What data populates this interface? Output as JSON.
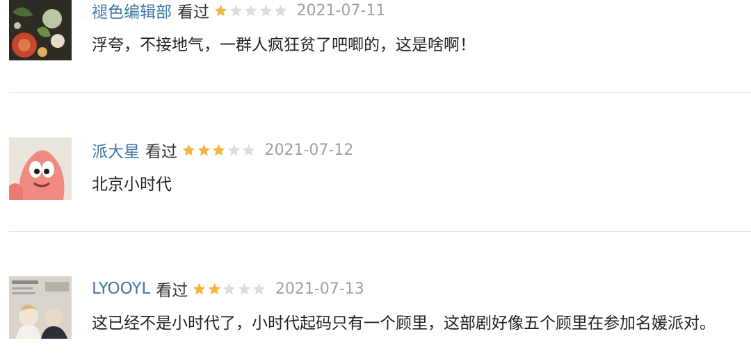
{
  "comments": [
    {
      "username": "褪色编辑部",
      "status": "看过",
      "rating": 1,
      "date": "2021-07-11",
      "text": "浮夸，不接地气，一群人疯狂贫了吧唧的，这是啥啊！",
      "avatar": "avatar-floral"
    },
    {
      "username": "派大星",
      "status": "看过",
      "rating": 3,
      "date": "2021-07-12",
      "text": "北京小时代",
      "avatar": "avatar-patrick"
    },
    {
      "username": "LYOOYL",
      "status": "看过",
      "rating": 2,
      "date": "2021-07-13",
      "text": "这已经不是小时代了，小时代起码只有一个顾里，这部剧好像五个顾里在参加名媛派对。",
      "avatar": "avatar-magazine"
    }
  ],
  "colors": {
    "username": "#3f77a6",
    "star_on": "#f7b43a",
    "star_off": "#dcdcdc",
    "date": "#a0a0a0",
    "divider": "#e6e6e6"
  }
}
